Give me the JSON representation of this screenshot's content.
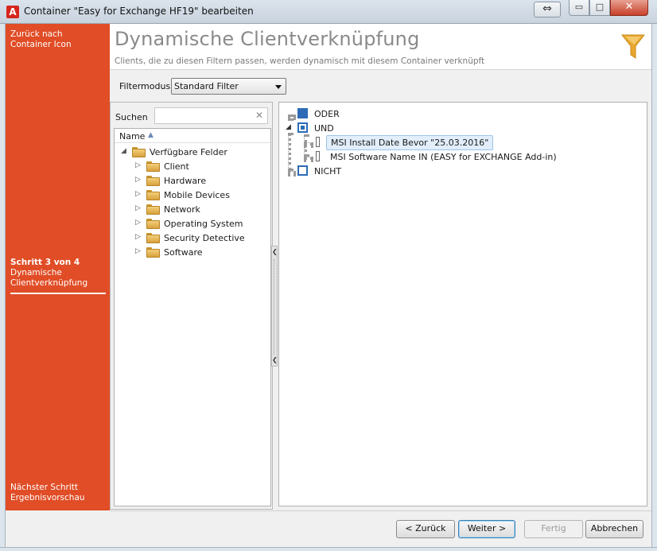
{
  "window": {
    "title": "Container \"Easy for Exchange HF19\" bearbeiten",
    "app_icon": "A",
    "controls": {
      "swap": "⇔",
      "minimize": "▭",
      "maximize": "□",
      "close": "✕"
    }
  },
  "sidebar": {
    "back_line1": "Zurück nach",
    "back_line2": "Container Icon",
    "step": "Schritt 3 von 4",
    "current_line1": "Dynamische",
    "current_line2": "Clientverknüpfung",
    "next_line1": "Nächster Schritt",
    "next_line2": "Ergebnisvorschau",
    "color": "#e04d26"
  },
  "header": {
    "title": "Dynamische Clientverknüpfung",
    "subtitle": "Clients, die zu diesen Filtern passen, werden dynamisch mit diesem Container verknüpft",
    "icon": "filter-funnel-icon",
    "icon_color": "#e8a82e"
  },
  "filter_mode": {
    "label": "Filtermodus:",
    "selected": "Standard Filter"
  },
  "search": {
    "label": "Suchen",
    "value": "",
    "clear": "✕"
  },
  "field_tree": {
    "column": "Name",
    "root": "Verfügbare Felder",
    "items": [
      "Client",
      "Hardware",
      "Mobile Devices",
      "Network",
      "Operating System",
      "Security Detective",
      "Software"
    ]
  },
  "filter_tree": {
    "or_label": "ODER",
    "and_label": "UND",
    "conditions": [
      "MSI Install Date Bevor  \"25.03.2016\"",
      "MSI Software Name IN (EASY for EXCHANGE Add-in)"
    ],
    "not_label": "NICHT",
    "accent_color": "#2d6bb6"
  },
  "buttons": {
    "back": "< Zurück",
    "next": "Weiter >",
    "finish": "Fertig",
    "cancel": "Abbrechen"
  }
}
